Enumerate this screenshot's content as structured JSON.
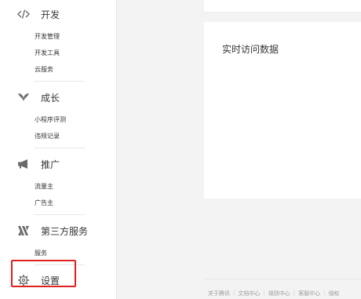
{
  "sidebar": {
    "sections": [
      {
        "label": "开发",
        "icon": "code-icon",
        "items": [
          "开发管理",
          "开发工具",
          "云服务"
        ]
      },
      {
        "label": "成长",
        "icon": "leaf-icon",
        "items": [
          "小程序评测",
          "违规记录"
        ]
      },
      {
        "label": "推广",
        "icon": "megaphone-icon",
        "items": [
          "流量主",
          "广告主"
        ]
      },
      {
        "label": "第三方服务",
        "icon": "third-party-logo-icon",
        "items": [
          "服务"
        ]
      },
      {
        "label": "设置",
        "icon": "gear-icon",
        "items": []
      }
    ]
  },
  "main": {
    "card_title": "实时访问数据"
  },
  "footer": {
    "links": [
      "关于腾讯",
      "文档中心",
      "规则中心",
      "客服中心",
      "侵权"
    ]
  },
  "colors": {
    "highlight_border": "#e02020",
    "background": "#f3f3f4"
  }
}
